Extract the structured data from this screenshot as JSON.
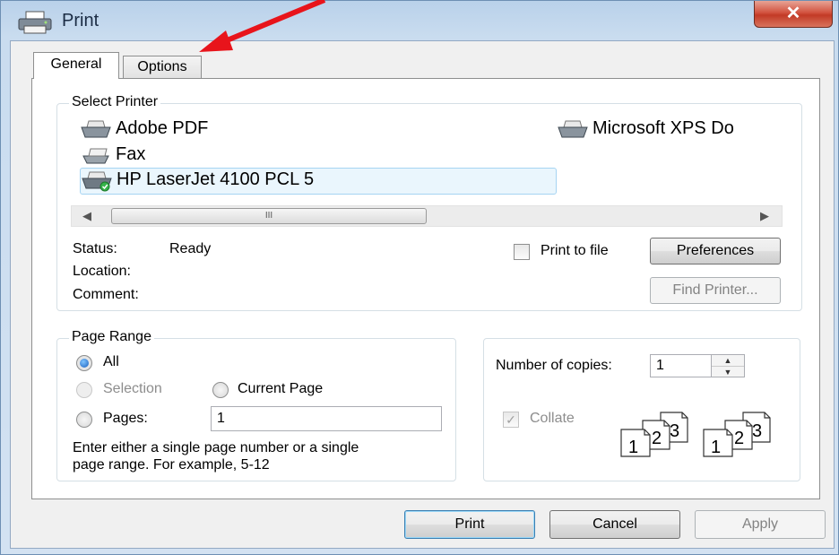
{
  "window": {
    "title": "Print",
    "close_glyph": "✕",
    "icon": "printer-icon"
  },
  "tabs": [
    {
      "label": "General",
      "active": true
    },
    {
      "label": "Options",
      "active": false
    }
  ],
  "select_printer": {
    "group_label": "Select Printer",
    "printers": [
      {
        "name": "Adobe PDF",
        "icon": "printer-icon"
      },
      {
        "name": "Microsoft XPS Do",
        "icon": "printer-icon"
      },
      {
        "name": "Fax",
        "icon": "fax-icon"
      },
      {
        "name": "HP LaserJet 4100 PCL 5",
        "icon": "default-printer-icon",
        "selected": true
      }
    ],
    "scrollbar": {
      "thumb_grip": "III"
    },
    "status_label": "Status:",
    "status_value": "Ready",
    "location_label": "Location:",
    "comment_label": "Comment:",
    "print_to_file_label": "Print to file",
    "print_to_file_checked": false,
    "preferences_label": "Preferences",
    "find_printer_label": "Find Printer..."
  },
  "page_range": {
    "group_label": "Page Range",
    "all_label": "All",
    "selection_label": "Selection",
    "current_page_label": "Current Page",
    "pages_label": "Pages:",
    "pages_value": "1",
    "hint_line1": "Enter either a single page number or a single",
    "hint_line2": "page range.  For example, 5-12",
    "selected": "All"
  },
  "copies": {
    "label": "Number of copies:",
    "value": "1",
    "collate_label": "Collate",
    "collate_checked": true,
    "collate_pages": [
      "1",
      "2",
      "3"
    ]
  },
  "buttons": {
    "print": "Print",
    "cancel": "Cancel",
    "apply": "Apply"
  },
  "colors": {
    "annotation_arrow": "#e8141b",
    "selection_highlight": "#eaf6fd"
  }
}
